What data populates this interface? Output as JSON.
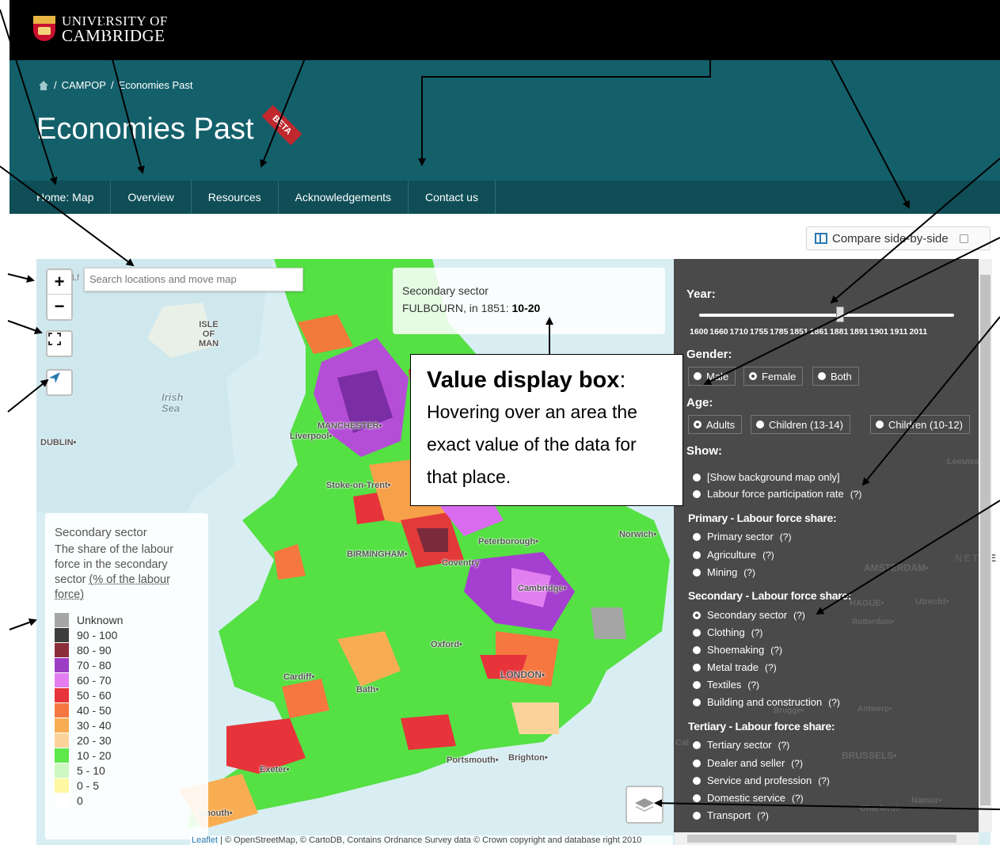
{
  "header": {
    "logo_line1": "UNIVERSITY OF",
    "logo_line2": "CAMBRIDGE",
    "breadcrumb_sep": "/",
    "breadcrumb_campop": "CAMPOP",
    "breadcrumb_current": "Economies Past",
    "title": "Economies Past",
    "badge": "BETA"
  },
  "nav": [
    "Home: Map",
    "Overview",
    "Resources",
    "Acknowledgements",
    "Contact us"
  ],
  "compare": {
    "label": "Compare side-by-side",
    "checked": false
  },
  "map": {
    "search_placeholder": "Search locations and move map",
    "search_cut_text": "Lf",
    "zoom_in": "+",
    "zoom_out": "−",
    "value_box": {
      "title": "Secondary sector",
      "place_prefix": "FULBOURN, in 1851:",
      "value": "10-20"
    },
    "legend": {
      "title": "Secondary sector",
      "desc_prefix": "The share of the labour force in the secondary sector",
      "desc_link": "(% of the labour force)",
      "items": [
        {
          "label": "Unknown",
          "color": "#a6a6a6"
        },
        {
          "label": "90 - 100",
          "color": "#3d3d3d"
        },
        {
          "label": "80 - 90",
          "color": "#8c2d3a"
        },
        {
          "label": "70 - 80",
          "color": "#9c3ec4"
        },
        {
          "label": "60 - 70",
          "color": "#e37ef0"
        },
        {
          "label": "50 - 60",
          "color": "#e6343a"
        },
        {
          "label": "40 - 50",
          "color": "#f6773f"
        },
        {
          "label": "30 - 40",
          "color": "#f9ad52"
        },
        {
          "label": "20 - 30",
          "color": "#fbd39a"
        },
        {
          "label": "10 - 20",
          "color": "#5ee84a"
        },
        {
          "label": "5 - 10",
          "color": "#cdf7c0"
        },
        {
          "label": "0 - 5",
          "color": "#fff7a3"
        },
        {
          "label": "0",
          "color": "#ffffff"
        }
      ]
    },
    "places": {
      "isle_of_man": "ISLE\nOF\nMAN",
      "irish_sea": "Irish\nSea",
      "dublin": "DUBLIN•",
      "manchester": "MANCHESTER•",
      "liverpool": "Liverpool•",
      "stoke": "Stoke-on-Trent•",
      "birmingham": "BIRMINGHAM•",
      "peterborough": "Peterborough•",
      "norwich": "Norwich•",
      "coventry": "Coventry",
      "cambridge": "Cambridge•",
      "oxford": "Oxford•",
      "london": "LONDON•",
      "cardiff": "Cardiff•",
      "bath": "Bath•",
      "portsmouth": "Portsmouth•",
      "brighton": "Brighton•",
      "exeter": "Exeter•",
      "plymouth": "ymouth•"
    },
    "attribution_link": "Leaflet",
    "attribution_rest": " | © OpenStreetMap, © CartoDB, Contains Ordnance Survey data © Crown copyright and database right 2010"
  },
  "panel": {
    "year_label": "Year:",
    "years": "1600 1660 1710 1755 1785 1851 1861 1881 1891 1901 1911 2011",
    "selected_year": "1851",
    "gender_label": "Gender:",
    "gender_options": [
      "Male",
      "Female",
      "Both"
    ],
    "gender_selected": "Female",
    "age_label": "Age:",
    "age_options": [
      "Adults",
      "Children (13-14)",
      "Children (10-12)"
    ],
    "age_selected": "Adults",
    "show_label": "Show:",
    "show_options": [
      "[Show background map only]",
      "Labour force participation rate"
    ],
    "primary_title": "Primary - Labour force share:",
    "primary_options": [
      "Primary sector",
      "Agriculture",
      "Mining"
    ],
    "secondary_title": "Secondary - Labour force share:",
    "secondary_options": [
      "Secondary sector",
      "Clothing",
      "Shoemaking",
      "Metal trade",
      "Textiles",
      "Building and construction"
    ],
    "secondary_selected": "Secondary sector",
    "tertiary_title": "Tertiary - Labour force share:",
    "tertiary_options": [
      "Tertiary sector",
      "Dealer and seller",
      "Service and profession",
      "Domestic service",
      "Transport"
    ],
    "help": "(?)",
    "bg_places": {
      "leeuwarden": "Leeuwarde",
      "neth": "NETHE",
      "amsterdam": "AMSTERDAM•",
      "hague": "HAGUE•",
      "utrecht": "Utrecht•",
      "rotterdam": "Rotterdam•",
      "brugge": "Brugge•",
      "antwerp": "Antwerp•",
      "brussels": "BRUSSELS•",
      "calais": "Cal",
      "namur": "Namur•",
      "charleroi": "Charleroi•"
    }
  },
  "callout": {
    "heading_bold": "Value display box",
    "heading_colon": ":",
    "body": "Hovering over an area the exact value of the data for that place."
  }
}
